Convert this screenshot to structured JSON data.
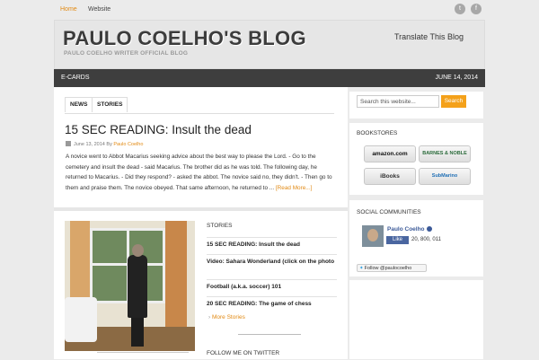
{
  "top_nav": {
    "home": "Home",
    "website": "Website"
  },
  "header": {
    "title": "PAULO COELHO'S BLOG",
    "tagline": "PAULO COELHO WRITER OFFICIAL BLOG",
    "translate": "Translate This Blog"
  },
  "menubar": {
    "ecards": "E-CARDS",
    "date": "JUNE 14, 2014"
  },
  "tabs": {
    "news": "NEWS",
    "stories": "STORIES"
  },
  "post": {
    "title": "15 SEC READING: Insult the dead",
    "date": "June 13, 2014",
    "by": "By",
    "author": "Paulo Coelho",
    "excerpt": "A novice went to Abbot Macarius seeking advice about the best way to please the Lord. - Go to the cemetery and insult the dead - said Macarius. The brother did as he was told. The following day, he returned to Macarius. - Did they respond? - asked the abbot. The novice said no, they didn't. - Then go to them and praise them. The novice obeyed. That same afternoon, he returned to ...",
    "read_more": "[Read More...]"
  },
  "stories": {
    "title": "STORIES",
    "items": [
      "15 SEC READING: Insult the dead",
      "Video: Sahara Wonderland (click on the photo",
      "Football (a.k.a. soccer) 101",
      "20 SEC READING: The game of chess"
    ],
    "more": "More Stories"
  },
  "follow_twitter_title": "FOLLOW ME ON TWITTER",
  "sidebar": {
    "search_placeholder": "Search this website...",
    "search_button": "Search",
    "bookstores_title": "BOOKSTORES",
    "stores": [
      "amazon.com",
      "BARNES & NOBLE",
      "iBooks",
      "SubMarino"
    ],
    "social_title": "SOCIAL COMMUNITIES",
    "fb_name": "Paulo Coelho",
    "fb_like": "Like",
    "fb_count": "20, 800, 011",
    "twitter_follow": "Follow @paulocoelho"
  },
  "colors": {
    "accent": "#e28a14",
    "menubar": "#3e3e3e",
    "search_button": "#f4a11a"
  }
}
